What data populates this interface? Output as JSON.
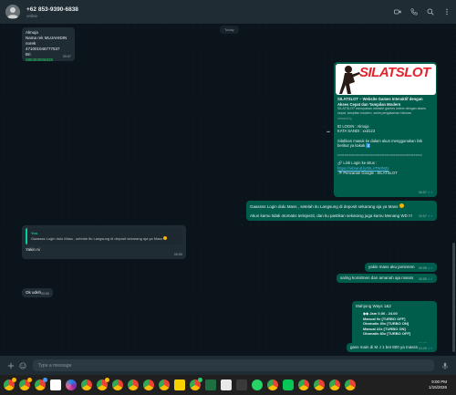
{
  "header": {
    "contact_name": "+62 853-9390-6838",
    "status": "online"
  },
  "day_label": "Today",
  "messages": {
    "m1": {
      "lines": [
        "Almuja",
        "Nama rek MUJAHIDIN",
        "norek 471001046777537",
        "Bri"
      ],
      "phone": "085393906838",
      "time": "00:57"
    },
    "m2": {
      "banner_text": "SILATSLOT",
      "title": "SILATSLOT – Website Games Interaktif dengan Akses Cepat dan Tampilan Modern",
      "desc": "SILATSLOT merupakan website games online dengan akses cepat, tampilan modern, serta pengalaman hiburan",
      "domain": "rebrand.ly",
      "login_id": "ID LOGIN : Almuja",
      "password": "KATA SANDI : xxd123",
      "instruction": "Silahkan masuk ke dalam akun menggunakan link berikut ya kakak",
      "divider": "======================================",
      "login_link_label": "Link Login ke situs :",
      "login_link": "https://rebrand.ly/SILATWIN01",
      "google_search": "Pencarian Google : SILATSLOT",
      "time": "00:57"
    },
    "m3": {
      "line1": "Gaassss Login dulu Mass , setelah itu Langsung di deposit sekarang aja ya Mass",
      "line2": "Akun kamu tidak otomatis terinjectit, dan ku pastikan sekarang juga kamu Menang WD !!!",
      "time": "00:57"
    },
    "m4": {
      "quote_name": "You",
      "quote_text": "Gaassss Login dulu Mass , setelah itu Langsung di deposit sekarang aja ya Mass",
      "text": "Yakin ni",
      "time": "00:59"
    },
    "m5": {
      "text": "yakin mass aku jaminnnn",
      "time": "00:59"
    },
    "m6": {
      "text": "saling komitmen dan amanah aja masss",
      "time": "00:59"
    },
    "m7": {
      "text": "Ok udeh",
      "time": "00:59"
    },
    "m8": {
      "title": "Mahjong Ways 1&2",
      "rows": [
        "Jam 0.00 - 24.00",
        "Manual      9x [TURBO OFF]",
        "Otomatis 30x [TURBO ON]",
        "Manual      22x [TURBO ON]",
        "Otomatis 80x [TURBO OFF]"
      ],
      "time": "01:00"
    },
    "m9": {
      "text": "gass main di M J 1 bet 800 ya masss",
      "time": "01:00"
    }
  },
  "composer": {
    "placeholder": "Type a message"
  },
  "taskbar": {
    "time": "9:00 PM",
    "date": "1/15/2026"
  },
  "colors": {
    "outgoing_bubble": "#005c4b",
    "incoming_bubble": "#202c33",
    "header": "#202c33",
    "accent_green": "#25d366",
    "link_blue": "#53bdeb"
  }
}
